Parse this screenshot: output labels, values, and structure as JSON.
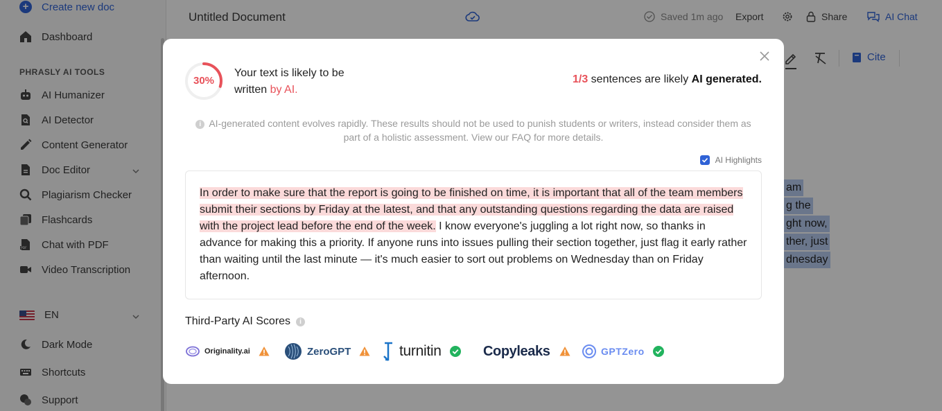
{
  "sidebar": {
    "create_new_doc": "Create new doc",
    "dashboard": "Dashboard",
    "section_label": "PHRASLY AI TOOLS",
    "items": [
      {
        "label": "AI Humanizer"
      },
      {
        "label": "AI Detector"
      },
      {
        "label": "Content Generator"
      },
      {
        "label": "Doc Editor"
      },
      {
        "label": "Plagiarism Checker"
      },
      {
        "label": "Flashcards"
      },
      {
        "label": "Chat with PDF"
      },
      {
        "label": "Video Transcription"
      }
    ],
    "language": "EN",
    "dark_mode": "Dark Mode",
    "shortcuts": "Shortcuts",
    "support": "Support"
  },
  "header": {
    "doc_title": "Untitled Document",
    "saved": "Saved 1m ago",
    "export": "Export",
    "share": "Share",
    "ai_chat": "AI Chat"
  },
  "toolbar": {
    "cite": "Cite"
  },
  "document_bg": {
    "lines": [
      "am",
      "g the",
      "ght now,",
      "ther, just",
      "dnesday"
    ]
  },
  "modal": {
    "score": "30%",
    "score_value": 0.3,
    "likely_line1": "Your text is likely to be",
    "likely_line2_prefix": "written ",
    "likely_line2_red": "by AI.",
    "sentences_count": "1/3",
    "sentences_mid": " sentences are likely ",
    "sentences_bold": "AI generated.",
    "disclaimer": "AI-generated content evolves rapidly. These results should not be used to punish students or writers, instead consider them as part of a holistic assessment. View our FAQ for more details.",
    "highlights_label": "AI Highlights",
    "text_highlighted": "In order to make sure that the report is going to be finished on time, it is important that all of the team members submit their sections by Friday at the latest, and that any outstanding questions regarding the data are raised with the project lead before the end of the week.",
    "text_plain": " I know everyone's juggling a lot right now, so thanks in advance for making this a priority. If anyone runs into issues pulling their section together, just flag it early rather than waiting until the last minute — it's much easier to sort out problems on Wednesday than on Friday afternoon.",
    "third_party_title": "Third-Party AI Scores",
    "scores": [
      {
        "name": "Originality.ai",
        "status": "warning"
      },
      {
        "name": "ZeroGPT",
        "status": "warning"
      },
      {
        "name": "turnitin",
        "status": "pass"
      },
      {
        "name": "Copyleaks",
        "status": "warning"
      },
      {
        "name": "GPTZero",
        "status": "pass"
      }
    ]
  },
  "colors": {
    "accent": "#2f62d6",
    "red": "#e8525a",
    "warning": "#f0923a",
    "pass": "#22b35e",
    "highlight": "#fbdada"
  }
}
